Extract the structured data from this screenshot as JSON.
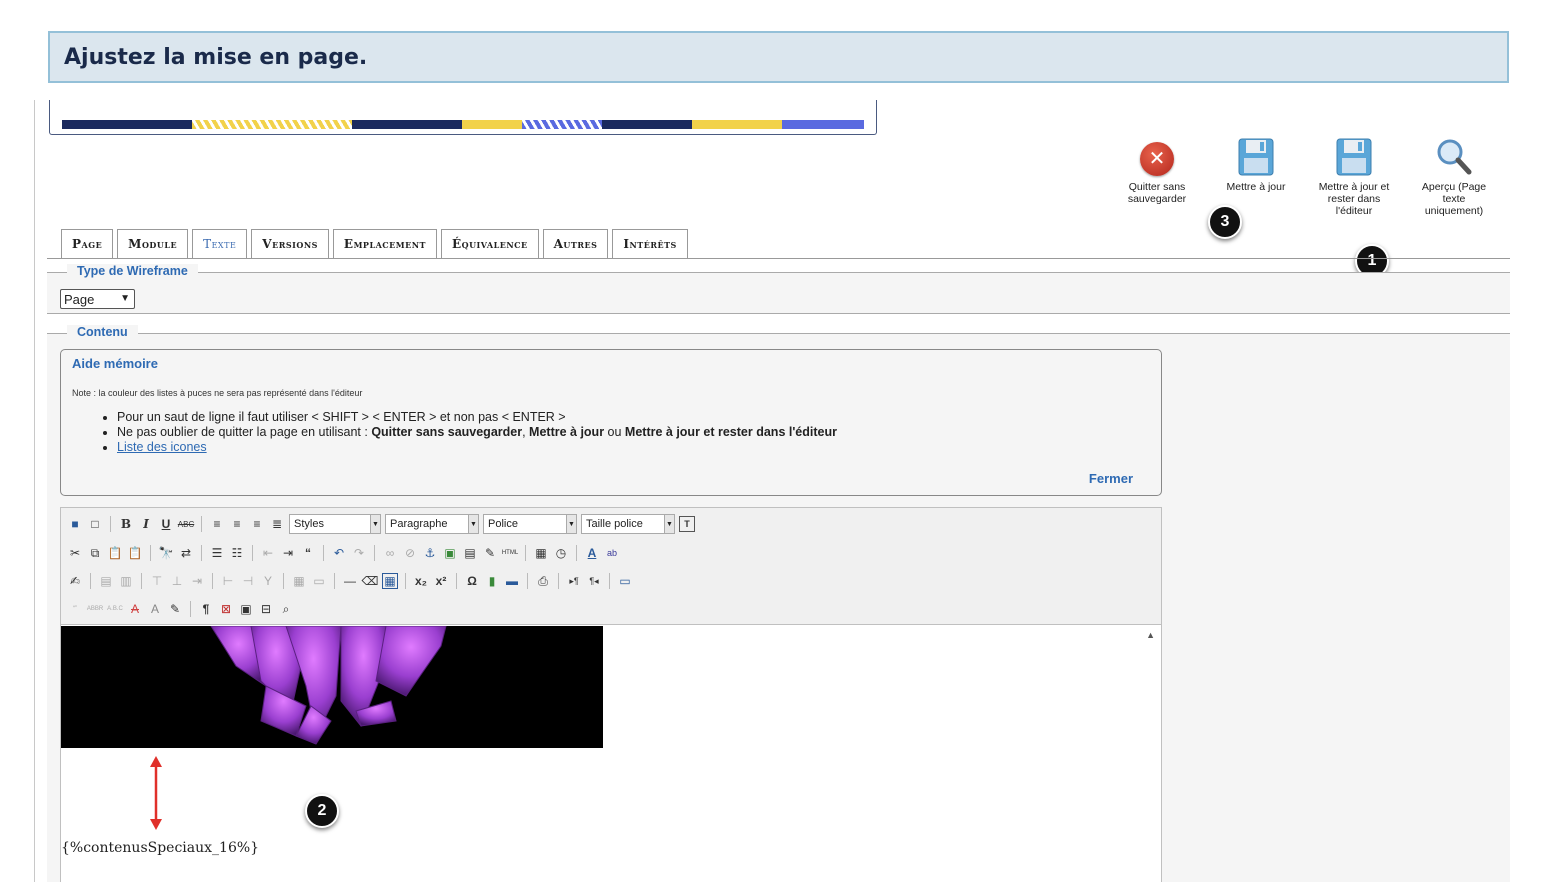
{
  "header": {
    "title": "Ajustez la mise en page."
  },
  "actions": {
    "quit": "Quitter sans sauvegarder",
    "update": "Mettre à jour",
    "update_stay": "Mettre à jour et rester dans l'éditeur",
    "preview": "Aperçu (Page texte uniquement)"
  },
  "badges": {
    "one": "1",
    "two": "2",
    "three": "3"
  },
  "tabs": [
    "Page",
    "Module",
    "Texte",
    "Versions",
    "Emplacement",
    "Équivalence",
    "Autres",
    "Intérêts"
  ],
  "wireframe": {
    "legend": "Type de Wireframe",
    "selected": "Page"
  },
  "contenu": {
    "legend": "Contenu",
    "aide": {
      "title": "Aide mémoire",
      "note": "Note : la couleur des listes à puces ne sera pas représenté dans l'éditeur",
      "item1": "Pour un saut de ligne il faut utiliser < SHIFT > < ENTER > et non pas < ENTER >",
      "item2_prefix": "Ne pas oublier de quitter la page en utilisant : ",
      "item2_b1": "Quitter sans sauvegarder",
      "item2_mid1": ", ",
      "item2_b2": "Mettre à jour",
      "item2_mid2": " ou ",
      "item2_b3": "Mettre à jour et rester dans l'éditeur",
      "item3": "Liste des icones",
      "close": "Fermer"
    }
  },
  "toolbar": {
    "styles": "Styles",
    "paragraph": "Paragraphe",
    "font": "Police",
    "font_size": "Taille police"
  },
  "editor": {
    "placeholder": "{%contenusSpeciaux_16%}"
  }
}
